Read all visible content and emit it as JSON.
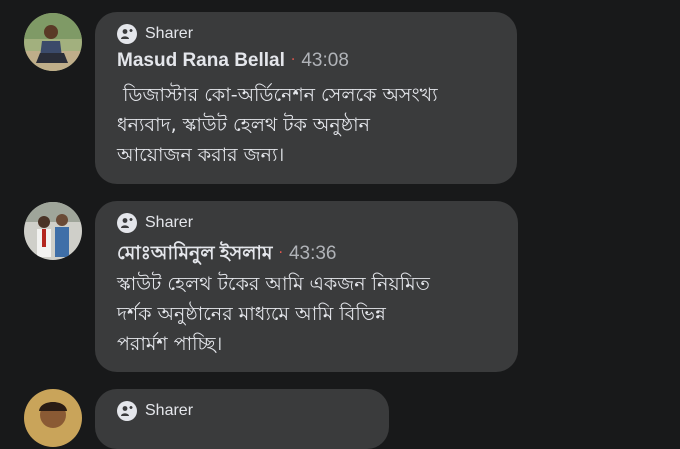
{
  "comments": [
    {
      "badge": "Sharer",
      "author": "Masud Rana Bellal",
      "separator": "·",
      "time": "43:08",
      "text": " ডিজাস্টার কো-অর্ডিনেশন সেলকে অসংখ্য\nধন্যবাদ, স্কাউট হেলথ টক অনুষ্ঠান\nআয়োজন করার জন্য।"
    },
    {
      "badge": "Sharer",
      "author": "মোঃআমিনুল ইসলাম",
      "separator": "·",
      "time": "43:36",
      "text": "স্কাউট হেলথ টকের আমি একজন নিয়মিত\nদর্শক অনুষ্ঠানের মাধ্যমে আমি বিভিন্ন\nপরার্মশ পাচ্ছি।"
    },
    {
      "badge": "Sharer"
    }
  ]
}
